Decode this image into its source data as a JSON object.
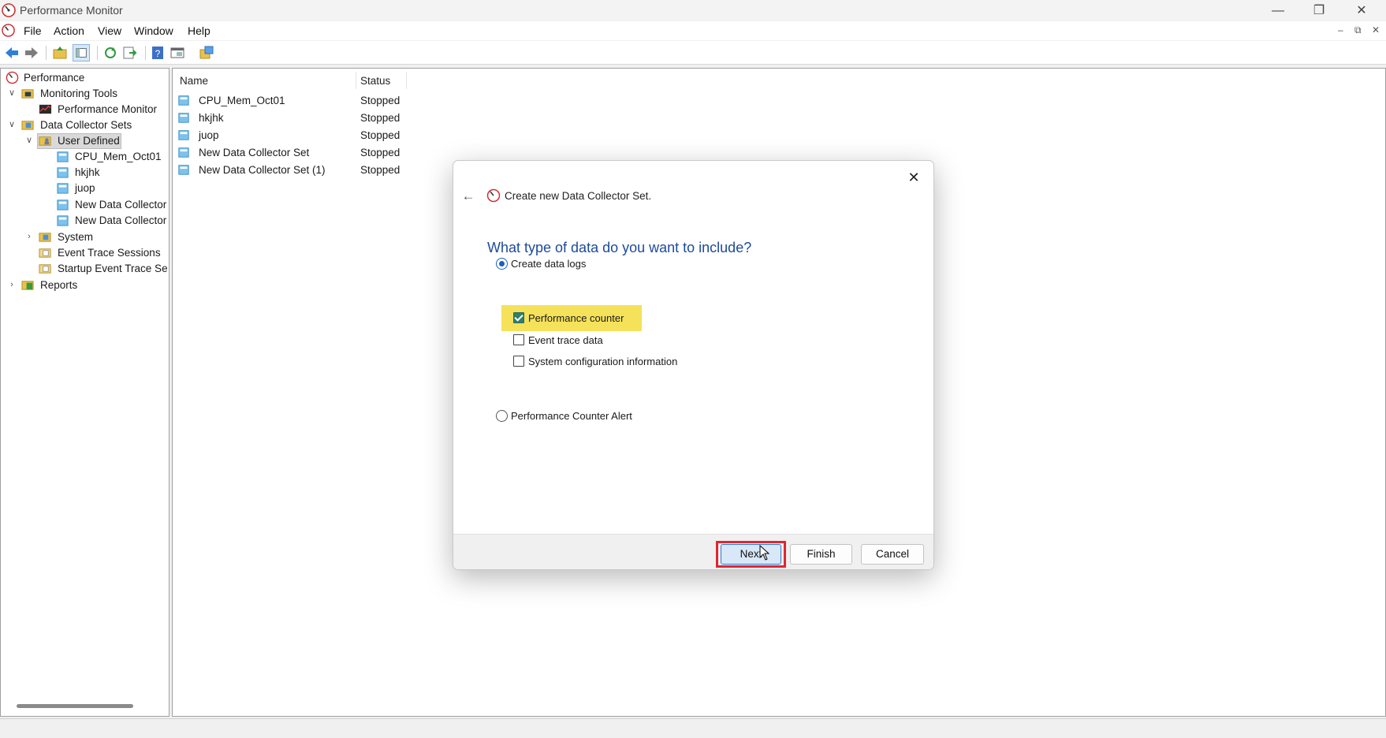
{
  "window": {
    "title": "Performance Monitor"
  },
  "menu": {
    "items": [
      "File",
      "Action",
      "View",
      "Window",
      "Help"
    ]
  },
  "tree": {
    "root": "Performance",
    "monitoring_tools": "Monitoring Tools",
    "performance_monitor": "Performance Monitor",
    "data_collector_sets": "Data Collector Sets",
    "user_defined": "User Defined",
    "user_defined_children": [
      "CPU_Mem_Oct01",
      "hkjhk",
      "juop",
      "New Data Collector",
      "New Data Collector"
    ],
    "system": "System",
    "event_trace_sessions": "Event Trace Sessions",
    "startup_event_trace": "Startup Event Trace Sess",
    "reports": "Reports"
  },
  "list": {
    "columns": {
      "name": "Name",
      "status": "Status"
    },
    "rows": [
      {
        "name": "CPU_Mem_Oct01",
        "status": "Stopped"
      },
      {
        "name": "hkjhk",
        "status": "Stopped"
      },
      {
        "name": "juop",
        "status": "Stopped"
      },
      {
        "name": "New Data Collector Set",
        "status": "Stopped"
      },
      {
        "name": "New Data Collector Set (1)",
        "status": "Stopped"
      }
    ]
  },
  "dialog": {
    "title": "Create new Data Collector Set.",
    "heading": "What type of data do you want to include?",
    "radio_create_logs": "Create data logs",
    "checkbox_perf_counter": "Performance counter",
    "checkbox_event_trace": "Event trace data",
    "checkbox_sys_config": "System configuration information",
    "radio_alert": "Performance Counter Alert",
    "states": {
      "create_logs_selected": true,
      "alert_selected": false,
      "perf_counter_checked": true,
      "event_trace_checked": false,
      "sys_config_checked": false
    },
    "buttons": {
      "next": "Next",
      "finish": "Finish",
      "cancel": "Cancel"
    }
  },
  "colors": {
    "heading_blue": "#1c4a9c",
    "highlight_yellow": "#f5e25a",
    "focus_red": "#e0262f",
    "radio_blue": "#1b5fbf"
  },
  "icons": [
    "perfmon-icon",
    "back-arrow-icon",
    "forward-arrow-icon",
    "up-folder-icon",
    "show-hide-tree-icon",
    "refresh-icon",
    "export-icon",
    "help-icon",
    "properties-icon",
    "new-window-icon",
    "collector-set-icon",
    "folder-icon",
    "close-icon"
  ]
}
